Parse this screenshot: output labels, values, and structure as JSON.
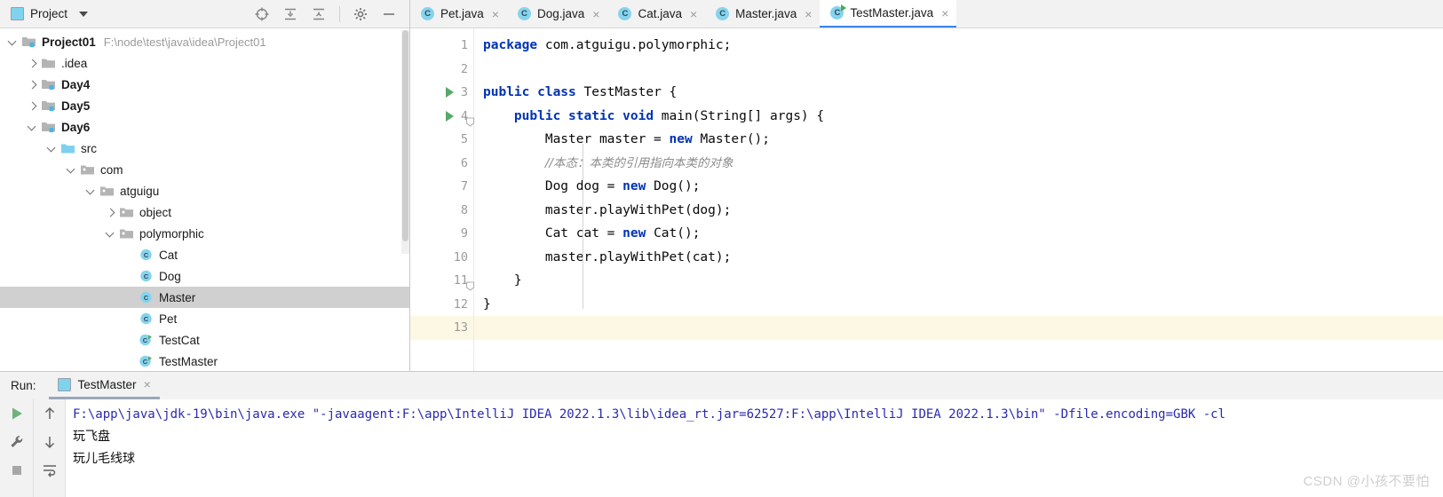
{
  "project_panel": {
    "title": "Project",
    "icons": [
      "project-select-icon",
      "expand-all-icon",
      "collapse-all-icon",
      "gear-icon",
      "hide-icon"
    ],
    "tree": [
      {
        "indent": 0,
        "twist": "down",
        "icon": "module-folder-icon",
        "label": "Project01",
        "bold": true,
        "path": "F:\\node\\test\\java\\idea\\Project01",
        "selected": false
      },
      {
        "indent": 1,
        "twist": "right",
        "icon": "folder-icon",
        "label": ".idea",
        "bold": false,
        "path": "",
        "selected": false
      },
      {
        "indent": 1,
        "twist": "right",
        "icon": "module-folder-icon",
        "label": "Day4",
        "bold": true,
        "path": "",
        "selected": false
      },
      {
        "indent": 1,
        "twist": "right",
        "icon": "module-folder-icon",
        "label": "Day5",
        "bold": true,
        "path": "",
        "selected": false
      },
      {
        "indent": 1,
        "twist": "down",
        "icon": "module-folder-icon",
        "label": "Day6",
        "bold": true,
        "path": "",
        "selected": false
      },
      {
        "indent": 2,
        "twist": "down",
        "icon": "source-folder-icon",
        "label": "src",
        "bold": false,
        "path": "",
        "selected": false
      },
      {
        "indent": 3,
        "twist": "down",
        "icon": "package-icon",
        "label": "com",
        "bold": false,
        "path": "",
        "selected": false
      },
      {
        "indent": 4,
        "twist": "down",
        "icon": "package-icon",
        "label": "atguigu",
        "bold": false,
        "path": "",
        "selected": false
      },
      {
        "indent": 5,
        "twist": "right",
        "icon": "package-icon",
        "label": "object",
        "bold": false,
        "path": "",
        "selected": false
      },
      {
        "indent": 5,
        "twist": "down",
        "icon": "package-icon",
        "label": "polymorphic",
        "bold": false,
        "path": "",
        "selected": false
      },
      {
        "indent": 6,
        "twist": "none",
        "icon": "java-class-icon",
        "label": "Cat",
        "bold": false,
        "path": "",
        "selected": false
      },
      {
        "indent": 6,
        "twist": "none",
        "icon": "java-class-icon",
        "label": "Dog",
        "bold": false,
        "path": "",
        "selected": false
      },
      {
        "indent": 6,
        "twist": "none",
        "icon": "java-class-icon",
        "label": "Master",
        "bold": false,
        "path": "",
        "selected": true
      },
      {
        "indent": 6,
        "twist": "none",
        "icon": "java-class-icon",
        "label": "Pet",
        "bold": false,
        "path": "",
        "selected": false
      },
      {
        "indent": 6,
        "twist": "none",
        "icon": "java-runnable-class-icon",
        "label": "TestCat",
        "bold": false,
        "path": "",
        "selected": false
      },
      {
        "indent": 6,
        "twist": "none",
        "icon": "java-runnable-class-icon",
        "label": "TestMaster",
        "bold": false,
        "path": "",
        "selected": false
      }
    ]
  },
  "editor": {
    "tabs": [
      {
        "label": "Pet.java",
        "icon": "java-class-icon",
        "active": false,
        "close": "×"
      },
      {
        "label": "Dog.java",
        "icon": "java-class-icon",
        "active": false,
        "close": "×"
      },
      {
        "label": "Cat.java",
        "icon": "java-class-icon",
        "active": false,
        "close": "×"
      },
      {
        "label": "Master.java",
        "icon": "java-class-icon",
        "active": false,
        "close": "×"
      },
      {
        "label": "TestMaster.java",
        "icon": "java-runnable-class-icon",
        "active": true,
        "close": "×"
      }
    ],
    "lines": [
      {
        "n": "1",
        "runmark": false,
        "fold": false,
        "current": false,
        "tokens": [
          {
            "t": "package",
            "c": "kw"
          },
          {
            "t": " com.atguigu.polymorphic;",
            "c": ""
          }
        ]
      },
      {
        "n": "2",
        "runmark": false,
        "fold": false,
        "current": false,
        "tokens": []
      },
      {
        "n": "3",
        "runmark": true,
        "fold": false,
        "current": false,
        "tokens": [
          {
            "t": "public class",
            "c": "kw"
          },
          {
            "t": " TestMaster {",
            "c": ""
          }
        ]
      },
      {
        "n": "4",
        "runmark": true,
        "fold": true,
        "current": false,
        "tokens": [
          {
            "t": "    ",
            "c": ""
          },
          {
            "t": "public static void",
            "c": "kw"
          },
          {
            "t": " main(String[] args) {",
            "c": ""
          }
        ]
      },
      {
        "n": "5",
        "runmark": false,
        "fold": false,
        "current": false,
        "tokens": [
          {
            "t": "        Master master = ",
            "c": ""
          },
          {
            "t": "new",
            "c": "kw"
          },
          {
            "t": " Master();",
            "c": ""
          }
        ]
      },
      {
        "n": "6",
        "runmark": false,
        "fold": false,
        "current": false,
        "tokens": [
          {
            "t": "        ",
            "c": ""
          },
          {
            "t": "//本态：本类的引用指向本类的对象",
            "c": "cm"
          }
        ]
      },
      {
        "n": "7",
        "runmark": false,
        "fold": false,
        "current": false,
        "tokens": [
          {
            "t": "        Dog dog = ",
            "c": ""
          },
          {
            "t": "new",
            "c": "kw"
          },
          {
            "t": " Dog();",
            "c": ""
          }
        ]
      },
      {
        "n": "8",
        "runmark": false,
        "fold": false,
        "current": false,
        "tokens": [
          {
            "t": "        master.playWithPet(dog);",
            "c": ""
          }
        ]
      },
      {
        "n": "9",
        "runmark": false,
        "fold": false,
        "current": false,
        "tokens": [
          {
            "t": "        Cat cat = ",
            "c": ""
          },
          {
            "t": "new",
            "c": "kw"
          },
          {
            "t": " Cat();",
            "c": ""
          }
        ]
      },
      {
        "n": "10",
        "runmark": false,
        "fold": false,
        "current": false,
        "tokens": [
          {
            "t": "        master.playWithPet(cat);",
            "c": ""
          }
        ]
      },
      {
        "n": "11",
        "runmark": false,
        "fold": true,
        "current": false,
        "tokens": [
          {
            "t": "    }",
            "c": ""
          }
        ]
      },
      {
        "n": "12",
        "runmark": false,
        "fold": false,
        "current": false,
        "tokens": [
          {
            "t": "}",
            "c": ""
          }
        ]
      },
      {
        "n": "13",
        "runmark": false,
        "fold": false,
        "current": true,
        "tokens": []
      }
    ]
  },
  "run_window": {
    "label": "Run:",
    "tab_label": "TestMaster",
    "tab_icon": "run-config-icon",
    "tab_close": "×",
    "side_icons": [
      "run-icon",
      "wrench-icon",
      "stop-icon"
    ],
    "side_icons2": [
      "up-arrow-icon",
      "down-arrow-icon",
      "soft-wrap-icon"
    ],
    "console": [
      {
        "type": "cmd",
        "text": "F:\\app\\java\\jdk-19\\bin\\java.exe \"-javaagent:F:\\app\\IntelliJ IDEA 2022.1.3\\lib\\idea_rt.jar=62527:F:\\app\\IntelliJ IDEA 2022.1.3\\bin\" -Dfile.encoding=GBK -cl"
      },
      {
        "type": "out",
        "text": "玩飞盘"
      },
      {
        "type": "out",
        "text": "玩儿毛线球"
      }
    ]
  },
  "watermark": "CSDN @小孩不要怕",
  "colors": {
    "accent": "#3f84ec",
    "keyword": "#0033b3",
    "comment": "#8c8c8c",
    "console_cmd": "#2a2ab0",
    "selection": "#d0d0d0",
    "current_line": "#fdf8e3",
    "run_green": "#59a869"
  }
}
